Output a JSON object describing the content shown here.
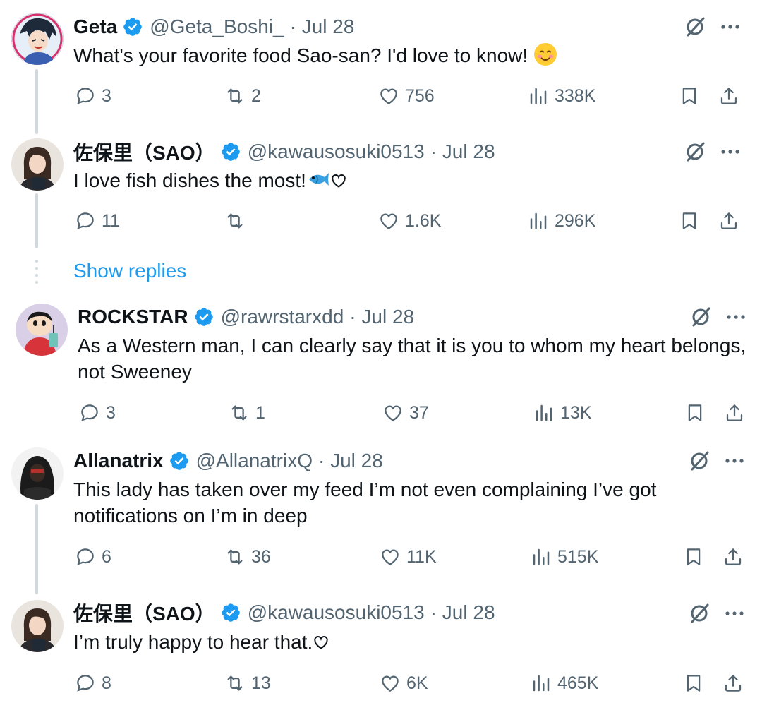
{
  "colors": {
    "text": "#0f1419",
    "secondary": "#536471",
    "accent": "#1d9bf0",
    "verified": "#1d9bf0",
    "thread_line": "#cfd9de"
  },
  "show_replies_label": "Show replies",
  "tweets": [
    {
      "name": "Geta",
      "handle": "@Geta_Boshi_",
      "date": "· Jul 28",
      "text": "What's your favorite food Sao-san? I'd love to know!",
      "emoji": "smiling-face-emoji",
      "replies": "3",
      "reposts": "2",
      "likes": "756",
      "views": "338K"
    },
    {
      "name": "佐保里（SAO）",
      "handle": "@kawausosuki0513",
      "date": "· Jul 28",
      "text": "I love fish dishes the most!",
      "emoji": "fish-emoji",
      "replies": "11",
      "reposts": "",
      "likes": "1.6K",
      "views": "296K"
    },
    {
      "name": "ROCKSTAR",
      "handle": "@rawrstarxdd",
      "date": "· Jul 28",
      "text_line1": "As a Western man, I can clearly say that it is you to whom my heart belongs,",
      "text_line2": "not Sweeney",
      "replies": "3",
      "reposts": "1",
      "likes": "37",
      "views": "13K"
    },
    {
      "name": "Allanatrix",
      "handle": "@AllanatrixQ",
      "date": "· Jul 28",
      "text_line1": "This lady has taken over my feed I’m not even complaining I’ve got",
      "text_line2": "notifications on I’m in deep",
      "replies": "6",
      "reposts": "36",
      "likes": "11K",
      "views": "515K"
    },
    {
      "name": "佐保里（SAO）",
      "handle": "@kawausosuki0513",
      "date": "· Jul 28",
      "text": "I’m truly happy to hear that.",
      "replies": "8",
      "reposts": "13",
      "likes": "6K",
      "views": "465K"
    }
  ]
}
